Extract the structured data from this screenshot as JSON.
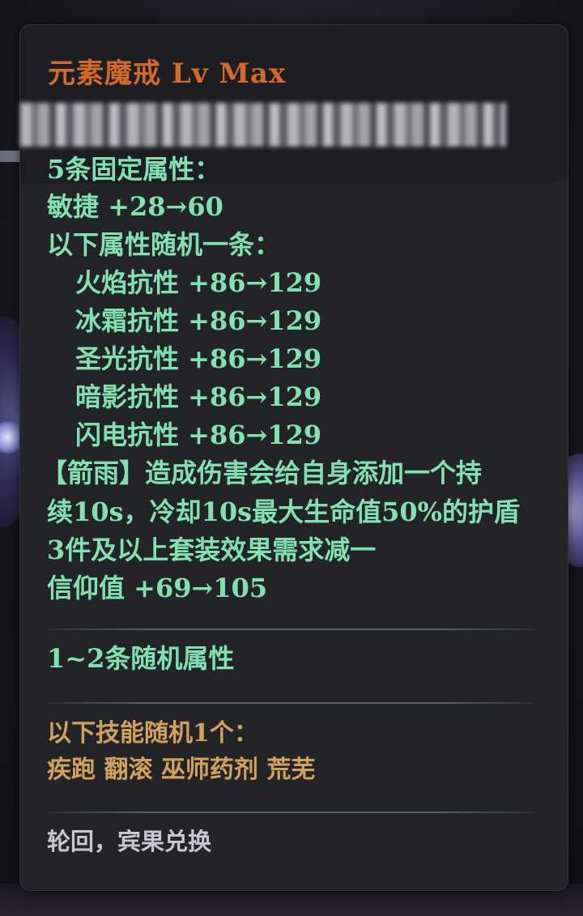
{
  "item": {
    "title": "元素魔戒 Lv Max"
  },
  "fixed_attributes": {
    "heading": "5条固定属性：",
    "agility": "敏捷 +28→60",
    "random_one_heading": "以下属性随机一条：",
    "resistances": [
      "火焰抗性 +86→129",
      "冰霜抗性 +86→129",
      "圣光抗性 +86→129",
      "暗影抗性 +86→129",
      "闪电抗性 +86→129"
    ],
    "arrow_rain_line1": "【箭雨】造成伤害会给自身添加一个持",
    "arrow_rain_line2": "续10s，冷却10s最大生命值50%的护盾",
    "set_bonus": "3件及以上套装效果需求减一",
    "faith": "信仰值 +69→105"
  },
  "random_attributes": {
    "label": "1~2条随机属性"
  },
  "skills": {
    "heading": "以下技能随机1个：",
    "list": "疾跑 翻滚 巫师药剂 荒芜"
  },
  "source": {
    "text": "轮回，宾果兑换"
  },
  "colors": {
    "title": "#d36a2a",
    "attribute_green": "#83e0b1",
    "skill_gold": "#d2a15e",
    "footer_grey": "#c7c8cf",
    "panel_bg": "#232428"
  }
}
